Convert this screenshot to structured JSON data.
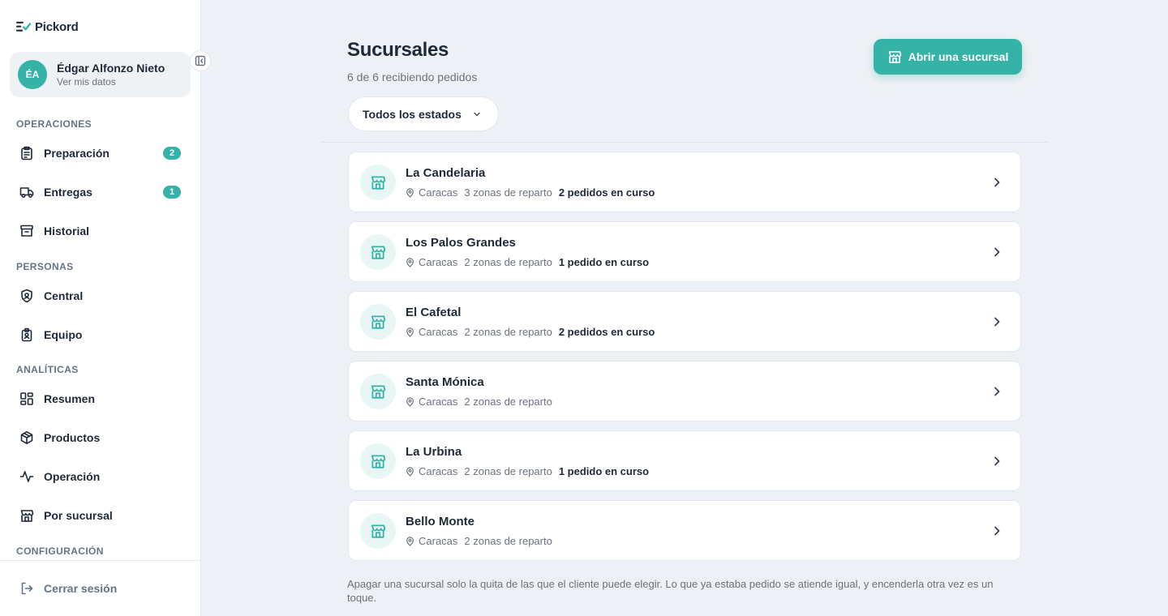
{
  "app": {
    "name": "Pickord",
    "brand_color": "#35b3a7"
  },
  "user": {
    "initials": "ÉA",
    "name": "Édgar Alfonzo Nieto",
    "subtitle": "Ver mis datos"
  },
  "sidebar": {
    "sections": [
      {
        "label": "OPERACIONES"
      },
      {
        "label": "PERSONAS"
      },
      {
        "label": "ANALÍTICAS"
      },
      {
        "label": "CONFIGURACIÓN"
      }
    ],
    "items": [
      {
        "label": "Preparación",
        "icon": "clipboard-list-icon",
        "badge": "2"
      },
      {
        "label": "Entregas",
        "icon": "truck-icon",
        "badge": "1"
      },
      {
        "label": "Historial",
        "icon": "archive-icon"
      },
      {
        "label": "Central",
        "icon": "shield-user-icon"
      },
      {
        "label": "Equipo",
        "icon": "id-badge-icon"
      },
      {
        "label": "Resumen",
        "icon": "dashboard-grid-icon"
      },
      {
        "label": "Productos",
        "icon": "package-icon"
      },
      {
        "label": "Operación",
        "icon": "activity-icon"
      },
      {
        "label": "Por sucursal",
        "icon": "store-icon"
      }
    ],
    "logout_label": "Cerrar sesión"
  },
  "main": {
    "title": "Sucursales",
    "subtitle": "6 de 6 recibiendo pedidos",
    "primary_button": "Abrir una sucursal",
    "filter_label": "Todos los estados",
    "branches": [
      {
        "name": "La Candelaria",
        "city": "Caracas",
        "zones": "3 zonas de reparto",
        "orders": "2 pedidos en curso"
      },
      {
        "name": "Los Palos Grandes",
        "city": "Caracas",
        "zones": "2 zonas de reparto",
        "orders": "1 pedido en curso"
      },
      {
        "name": "El Cafetal",
        "city": "Caracas",
        "zones": "2 zonas de reparto",
        "orders": "2 pedidos en curso"
      },
      {
        "name": "Santa Mónica",
        "city": "Caracas",
        "zones": "2 zonas de reparto",
        "orders": ""
      },
      {
        "name": "La Urbina",
        "city": "Caracas",
        "zones": "2 zonas de reparto",
        "orders": "1 pedido en curso"
      },
      {
        "name": "Bello Monte",
        "city": "Caracas",
        "zones": "2 zonas de reparto",
        "orders": ""
      }
    ],
    "footnote": "Apagar una sucursal solo la quita de las que el cliente puede elegir. Lo que ya estaba pedido se atiende igual, y encenderla otra vez es un toque."
  }
}
